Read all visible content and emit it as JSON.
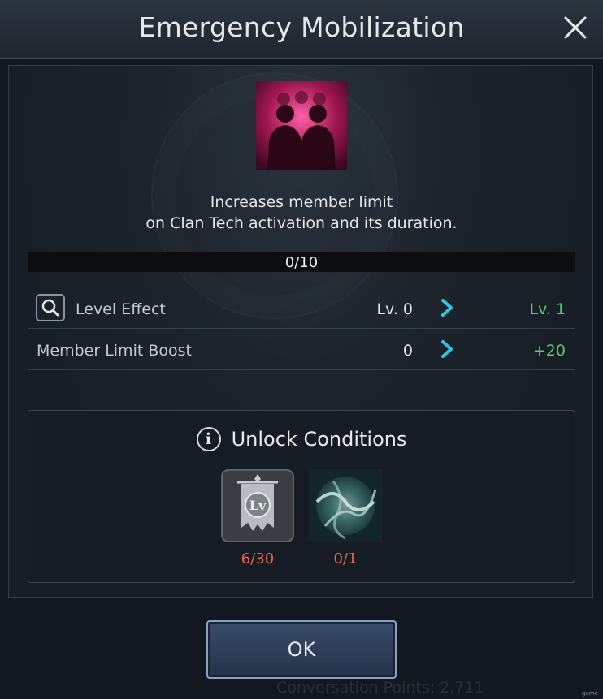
{
  "dialog": {
    "title": "Emergency Mobilization"
  },
  "description": {
    "line1": "Increases member limit",
    "line2": "on Clan Tech activation and its duration."
  },
  "progress": {
    "text": "0/10",
    "current": 0,
    "max": 10,
    "fill_color": "#b89b5e"
  },
  "stats": {
    "level_effect": {
      "label": "Level Effect",
      "current": "Lv. 0",
      "next": "Lv. 1"
    },
    "member_limit": {
      "label": "Member Limit Boost",
      "current": "0",
      "next": "+20"
    }
  },
  "unlock": {
    "title": "Unlock Conditions",
    "conditions": [
      {
        "icon": "level-banner-icon",
        "count": "6/30"
      },
      {
        "icon": "swirl-skill-icon",
        "count": "0/1"
      }
    ]
  },
  "buttons": {
    "ok": "OK"
  },
  "icons": {
    "close": "close-icon",
    "skill": "members-silhouette-icon",
    "magnify": "magnifier-icon",
    "arrow": "chevron-right-icon",
    "info": "info-icon"
  },
  "background_text": "Conversation Points: 2,711",
  "watermark": "game",
  "colors": {
    "positive": "#4fd05a",
    "negative": "#f2604f",
    "arrow": "#2ec8e6",
    "button": "#2c3c56"
  }
}
